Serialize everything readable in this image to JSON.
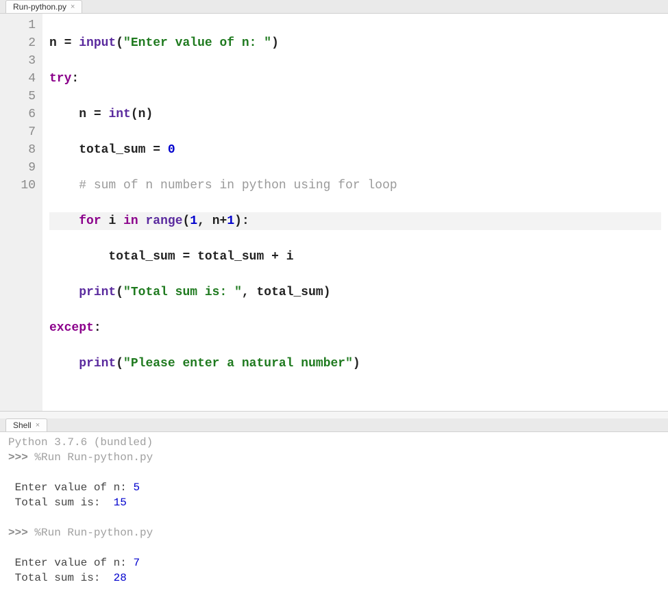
{
  "editor": {
    "tab": {
      "title": "Run-python.py",
      "close": "×"
    },
    "lines": [
      {
        "num": "1"
      },
      {
        "num": "2"
      },
      {
        "num": "3"
      },
      {
        "num": "4"
      },
      {
        "num": "5"
      },
      {
        "num": "6"
      },
      {
        "num": "7"
      },
      {
        "num": "8"
      },
      {
        "num": "9"
      },
      {
        "num": "10"
      }
    ],
    "tokens": {
      "l1": {
        "id1": "n ",
        "op": "= ",
        "fn": "input",
        "p1": "(",
        "str": "\"Enter value of n: \"",
        "p2": ")"
      },
      "l2": {
        "kw": "try",
        "p": ":"
      },
      "l3": {
        "indent": "    ",
        "id1": "n ",
        "op": "= ",
        "fn": "int",
        "p1": "(",
        "id2": "n",
        "p2": ")"
      },
      "l4": {
        "indent": "    ",
        "id1": "total_sum ",
        "op": "= ",
        "num": "0"
      },
      "l5": {
        "indent": "    ",
        "com": "# sum of n numbers in python using for loop"
      },
      "l6": {
        "indent": "    ",
        "kw1": "for",
        "sp1": " ",
        "id1": "i",
        "sp2": " ",
        "kw2": "in",
        "sp3": " ",
        "fn": "range",
        "p1": "(",
        "num1": "1",
        "c": ", ",
        "id2": "n",
        "op": "+",
        "num2": "1",
        "p2": "):"
      },
      "l7": {
        "indent": "        ",
        "id1": "total_sum ",
        "op1": "= ",
        "id2": "total_sum ",
        "op2": "+ ",
        "id3": "i"
      },
      "l8": {
        "indent": "    ",
        "fn": "print",
        "p1": "(",
        "str": "\"Total sum is: \"",
        "c": ", ",
        "id": "total_sum",
        "p2": ")"
      },
      "l9": {
        "kw": "except",
        "p": ":"
      },
      "l10": {
        "indent": "    ",
        "fn": "print",
        "p1": "(",
        "str": "\"Please enter a natural number\"",
        "p2": ")"
      }
    }
  },
  "shell": {
    "tab": {
      "title": "Shell",
      "close": "×"
    },
    "version": "Python 3.7.6 (bundled)",
    "prompt": ">>> ",
    "run1": "%Run Run-python.py",
    "out1a_label": " Enter value of n: ",
    "out1a_val": "5",
    "out1b_label": " Total sum is:  ",
    "out1b_val": "15",
    "run2": "%Run Run-python.py",
    "out2a_label": " Enter value of n: ",
    "out2a_val": "7",
    "out2b_label": " Total sum is:  ",
    "out2b_val": "28"
  }
}
